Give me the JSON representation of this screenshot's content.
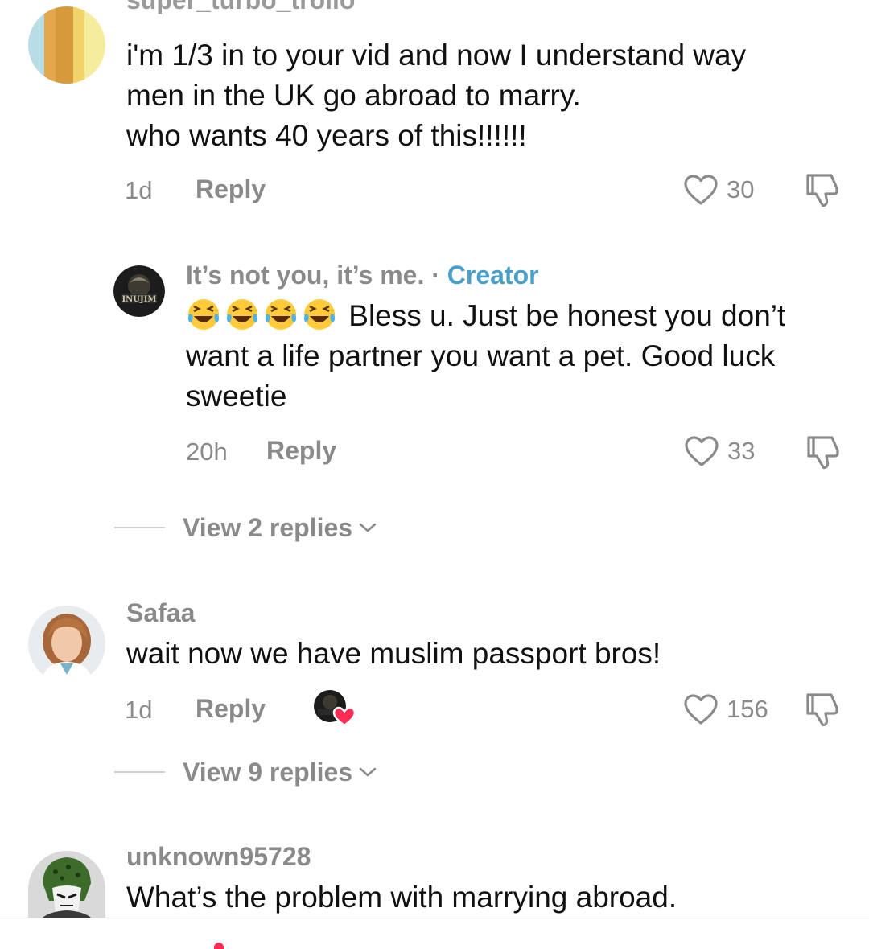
{
  "comments": [
    {
      "username": "super_turbo_trollo",
      "avatar_icon": "striped-yellow-avatar",
      "lines": [
        "i'm 1/3 in to your vid and now I understand way",
        "men in the UK go abroad to marry.",
        "who wants 40 years of this!!!!!!"
      ],
      "time": "1d",
      "reply_label": "Reply",
      "likes": "30"
    },
    {
      "username": "It’s not you, it’s me.",
      "separator": " · ",
      "creator_label": "Creator",
      "avatar_icon": "dark-logo-avatar",
      "emoji": "😂😂😂😂",
      "lines": [
        " Bless u. Just be honest you don’t",
        "want a life partner you want a pet. Good luck",
        "sweetie"
      ],
      "time": "20h",
      "reply_label": "Reply",
      "likes": "33",
      "view_replies": "View 2 replies"
    },
    {
      "username": "Safaa",
      "avatar_icon": "woman-portrait-avatar",
      "lines": [
        "wait now we have muslim passport bros!"
      ],
      "time": "1d",
      "reply_label": "Reply",
      "likes": "156",
      "liked_by_creator_icon": "creator-heart-icon",
      "view_replies": "View 9 replies"
    },
    {
      "username": "unknown95728",
      "avatar_icon": "green-character-avatar",
      "lines": [
        "What’s the problem with marrying abroad."
      ]
    }
  ],
  "colors": {
    "muted_text": "#8a8a8a",
    "creator_accent": "#4a9fc9",
    "heart_red": "#fe2c55"
  }
}
